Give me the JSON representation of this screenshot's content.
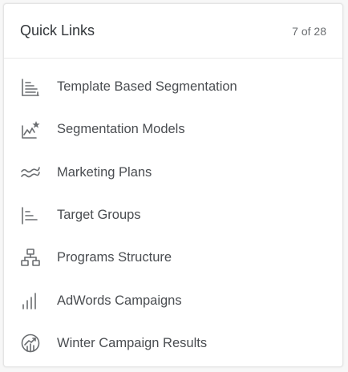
{
  "quick_links": {
    "title": "Quick Links",
    "count_text": "7 of 28",
    "items": [
      {
        "label": "Template Based Segmentation",
        "icon": "horizontal-bar-chart-icon"
      },
      {
        "label": "Segmentation Models",
        "icon": "line-chart-star-icon"
      },
      {
        "label": "Marketing Plans",
        "icon": "waves-icon"
      },
      {
        "label": "Target Groups",
        "icon": "horizontal-bars-icon"
      },
      {
        "label": "Programs Structure",
        "icon": "org-chart-icon"
      },
      {
        "label": "AdWords Campaigns",
        "icon": "vertical-bar-chart-icon"
      },
      {
        "label": "Winter Campaign Results",
        "icon": "trend-circle-icon"
      }
    ]
  },
  "colors": {
    "icon": "#6a6d70",
    "text": "#4a4d51",
    "title": "#32363a",
    "border": "#e4e4e4"
  }
}
